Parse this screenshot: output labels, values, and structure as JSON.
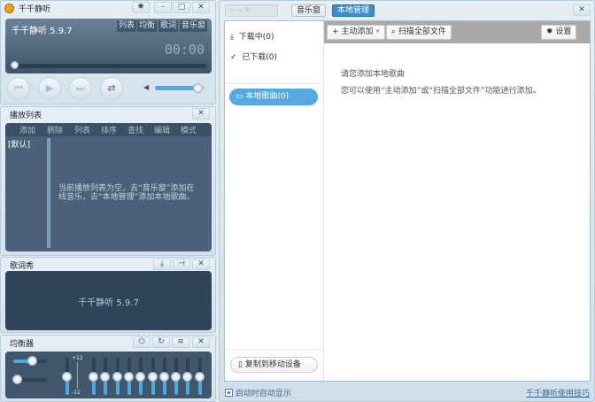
{
  "player": {
    "title": "千千静听",
    "version_text": "千千静听 5.9.7",
    "time": "00:00",
    "mode_buttons": [
      "列表",
      "均衡",
      "歌词",
      "音乐窗"
    ],
    "progress": 0,
    "volume": 0.85
  },
  "playlist": {
    "title": "播放列表",
    "menu": [
      "添加",
      "删除",
      "列表",
      "排序",
      "查找",
      "编辑",
      "模式"
    ],
    "lists": [
      "[默认]"
    ],
    "empty_message": "当前播放列表为空，去“音乐窗”添加在线音乐，去“本地管理”添加本地歌曲。"
  },
  "lyrics": {
    "title": "歌词秀",
    "text": "千千静听 5.9.7"
  },
  "equalizer": {
    "title": "均衡器",
    "scale_top": "+12",
    "scale_bottom": "-12",
    "top_slider_1": 0.55,
    "top_slider_2": 0.0,
    "preamp": 0.5,
    "bands": [
      0.5,
      0.5,
      0.5,
      0.5,
      0.5,
      0.5,
      0.5,
      0.5,
      0.5,
      0.5
    ]
  },
  "manager": {
    "tabs": [
      "音乐窗",
      "本地管理"
    ],
    "active_tab": "本地管理",
    "sidebar": {
      "downloading": "下载中(0)",
      "downloaded": "已下载(0)",
      "local_songs": "本地歌曲(0)",
      "copy_device": "复制到移动设备"
    },
    "toolbar": {
      "add": "主动添加",
      "scan": "扫描全部文件",
      "settings": "设置"
    },
    "empty_title": "请您添加本地歌曲",
    "empty_hint": "您可以使用“主动添加”或“扫描全部文件”功能进行添加。",
    "footer": {
      "auto_show": "启动时自动显示",
      "tips_link": "千千静听使用技巧"
    }
  },
  "colors": {
    "accent": "#4fa9dc",
    "dark_panel": "#4a6179",
    "lyrics_bg": "#2f445a"
  }
}
